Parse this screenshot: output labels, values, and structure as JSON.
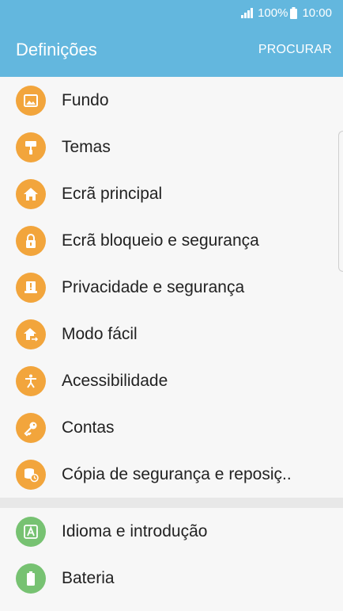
{
  "status": {
    "battery": "100%",
    "time": "10:00"
  },
  "header": {
    "title": "Definições",
    "search_label": "PROCURAR"
  },
  "groups": [
    {
      "items": [
        {
          "label": "Fundo",
          "icon": "wallpaper-icon",
          "color": "#f2a53c"
        },
        {
          "label": "Temas",
          "icon": "paint-roller-icon",
          "color": "#f2a53c"
        },
        {
          "label": "Ecrã principal",
          "icon": "home-icon",
          "color": "#f2a53c"
        },
        {
          "label": "Ecrã bloqueio e segurança",
          "icon": "lock-icon",
          "color": "#f2a53c"
        },
        {
          "label": "Privacidade e segurança",
          "icon": "privacy-icon",
          "color": "#f2a53c"
        },
        {
          "label": "Modo fácil",
          "icon": "easy-mode-icon",
          "color": "#f2a53c"
        },
        {
          "label": "Acessibilidade",
          "icon": "accessibility-icon",
          "color": "#f2a53c"
        },
        {
          "label": "Contas",
          "icon": "key-icon",
          "color": "#f2a53c"
        },
        {
          "label": "Cópia de segurança e reposiç..",
          "icon": "backup-icon",
          "color": "#f2a53c"
        }
      ]
    },
    {
      "items": [
        {
          "label": "Idioma e introdução",
          "icon": "language-icon",
          "color": "#77c272"
        },
        {
          "label": "Bateria",
          "icon": "battery-icon",
          "color": "#77c272"
        }
      ]
    }
  ]
}
